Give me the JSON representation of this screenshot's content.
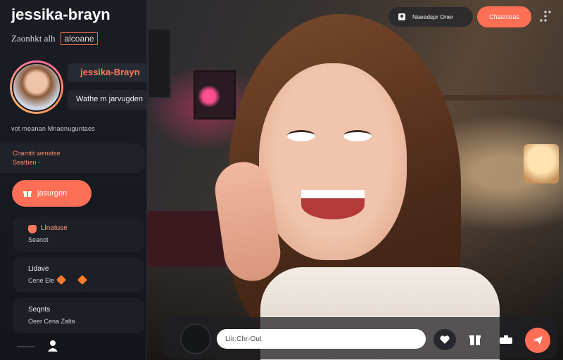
{
  "sidebar": {
    "app_title": "jessika-brayn",
    "subtitle": "Zaonhkt alh",
    "subtitle_tag": "alcoane",
    "profile": {
      "handle": "jessika-Brayn",
      "bio": "Wathe m jarvugden",
      "stats_line": "vot meanan Mnaenuguntaes"
    },
    "stat_box": {
      "line1": "Charntit wenatse",
      "line2": "Seatben -"
    },
    "join_button_label": "jasurgen",
    "cards": [
      {
        "title": "Llnatuse",
        "sub": "Seanot"
      },
      {
        "title": "Lidave",
        "sub_a": "Cene Ele"
      },
      {
        "title": "Seqnts",
        "sub": "Oeer Cena Zalta"
      }
    ]
  },
  "topbar": {
    "pill_label": "Naeedspr Oner",
    "cta_label": "Chasrceas"
  },
  "chat": {
    "placeholder": "Liir:Chr-Out"
  },
  "colors": {
    "accent": "#ff6f56",
    "sidebar_bg": "#1a1d24",
    "handle_text": "#ff7a59"
  },
  "icons": [
    "chat-bubble-icon",
    "heart-icon",
    "gift-icon",
    "camera-icon",
    "send-icon",
    "kebab-icon",
    "user-icon",
    "shield-icon"
  ]
}
